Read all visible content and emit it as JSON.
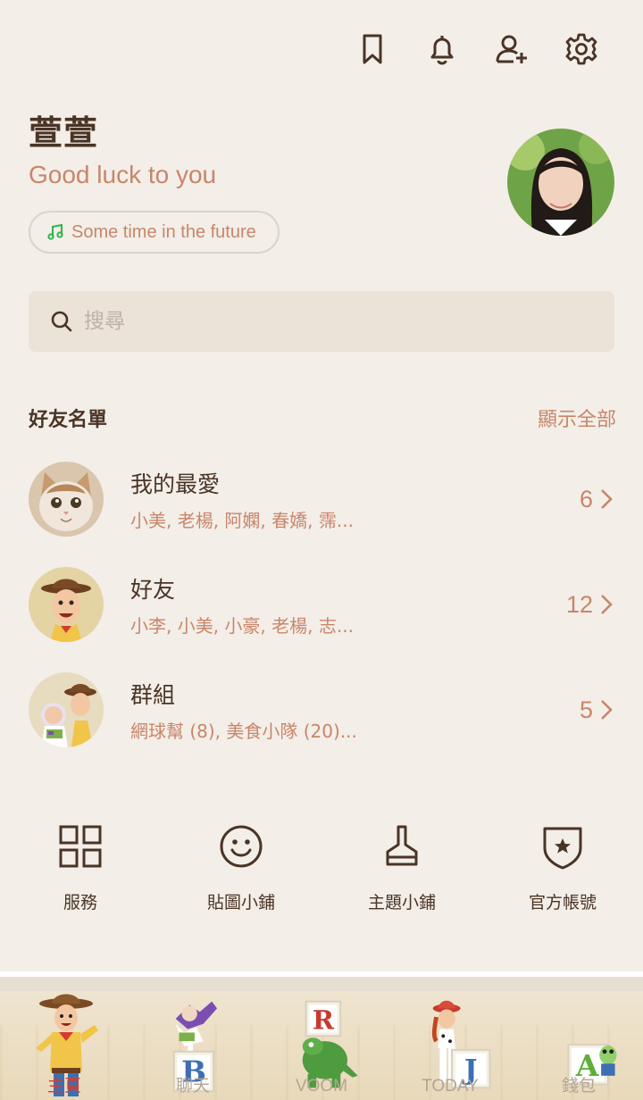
{
  "header": {
    "icons": [
      "bookmark-icon",
      "bell-icon",
      "add-friend-icon",
      "gear-icon"
    ]
  },
  "profile": {
    "name": "萱萱",
    "status": "Good luck to you",
    "music": "Some time in the future"
  },
  "search": {
    "placeholder": "搜尋"
  },
  "friends_section": {
    "title": "好友名單",
    "show_all": "顯示全部",
    "rows": [
      {
        "name": "我的最愛",
        "members": "小美, 老楊, 阿嫻, 春嬌, 霈...",
        "count": "6"
      },
      {
        "name": "好友",
        "members": "小李, 小美, 小豪, 老楊, 志...",
        "count": "12"
      },
      {
        "name": "群組",
        "members": "網球幫 (8), 美食小隊 (20)...",
        "count": "5"
      }
    ]
  },
  "services": [
    {
      "label": "服務",
      "icon": "grid-icon"
    },
    {
      "label": "貼圖小鋪",
      "icon": "smiley-icon"
    },
    {
      "label": "主題小鋪",
      "icon": "brush-icon"
    },
    {
      "label": "官方帳號",
      "icon": "shield-star-icon"
    }
  ],
  "bottom_nav": [
    {
      "label": "主頁",
      "active": true
    },
    {
      "label": "聊天",
      "letter": "B"
    },
    {
      "label": "VOOM",
      "letter": "R"
    },
    {
      "label": "TODAY",
      "letter": "J"
    },
    {
      "label": "錢包",
      "letter": "A"
    }
  ],
  "colors": {
    "accent": "#c8866a",
    "text": "#4a3426",
    "background": "#f3eee8",
    "active_tab": "#d63c2f"
  }
}
